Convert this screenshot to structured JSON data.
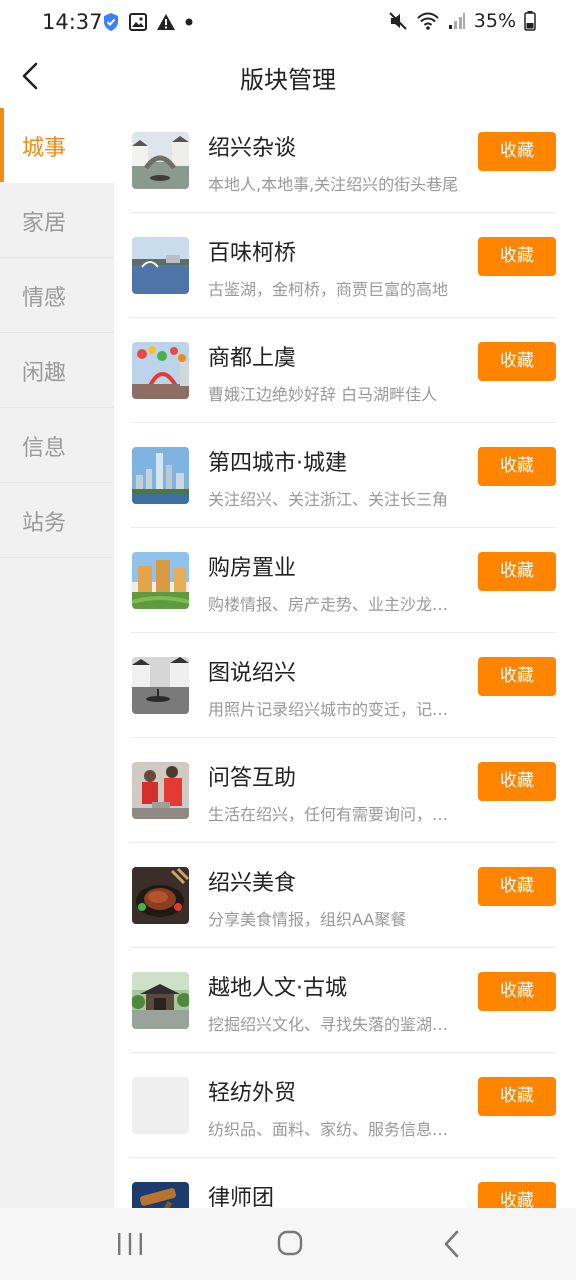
{
  "status_bar": {
    "time": "14:37",
    "battery": "35%"
  },
  "app_bar": {
    "title": "版块管理"
  },
  "sidebar": {
    "items": [
      {
        "label": "城事",
        "active": true
      },
      {
        "label": "家居",
        "active": false
      },
      {
        "label": "情感",
        "active": false
      },
      {
        "label": "闲趣",
        "active": false
      },
      {
        "label": "信息",
        "active": false
      },
      {
        "label": "站务",
        "active": false
      }
    ]
  },
  "forums": [
    {
      "title": "绍兴杂谈",
      "desc": "本地人,本地事,关注绍兴的街头巷尾",
      "button": "收藏",
      "thumb": "canal-bridge"
    },
    {
      "title": "百味柯桥",
      "desc": "古鉴湖，金柯桥，商贾巨富的高地",
      "button": "收藏",
      "thumb": "lake-bridge"
    },
    {
      "title": "商都上虞",
      "desc": "曹娥江边绝妙好辞 白马湖畔佳人",
      "button": "收藏",
      "thumb": "festival"
    },
    {
      "title": "第四城市·城建",
      "desc": "关注绍兴、关注浙江、关注长三角",
      "button": "收藏",
      "thumb": "skyline"
    },
    {
      "title": "购房置业",
      "desc": "购楼情报、房产走势、业主沙龙活动",
      "button": "收藏",
      "thumb": "apartments"
    },
    {
      "title": "图说绍兴",
      "desc": "用照片记录绍兴城市的变迁，记录生活",
      "button": "收藏",
      "thumb": "water-town"
    },
    {
      "title": "问答互助",
      "desc": "生活在绍兴，任何有需要询问，请来这里",
      "button": "收藏",
      "thumb": "volunteers"
    },
    {
      "title": "绍兴美食",
      "desc": "分享美食情报，组织AA聚餐",
      "button": "收藏",
      "thumb": "steak"
    },
    {
      "title": "越地人文·古城",
      "desc": "挖掘绍兴文化、寻找失落的鉴湖文明",
      "button": "收藏",
      "thumb": "pavilion"
    },
    {
      "title": "轻纺外贸",
      "desc": "纺织品、面料、家纺、服务信息交流",
      "button": "收藏",
      "thumb": "blank"
    },
    {
      "title": "律师团",
      "desc": "",
      "button": "收藏",
      "thumb": "gavel"
    }
  ]
}
